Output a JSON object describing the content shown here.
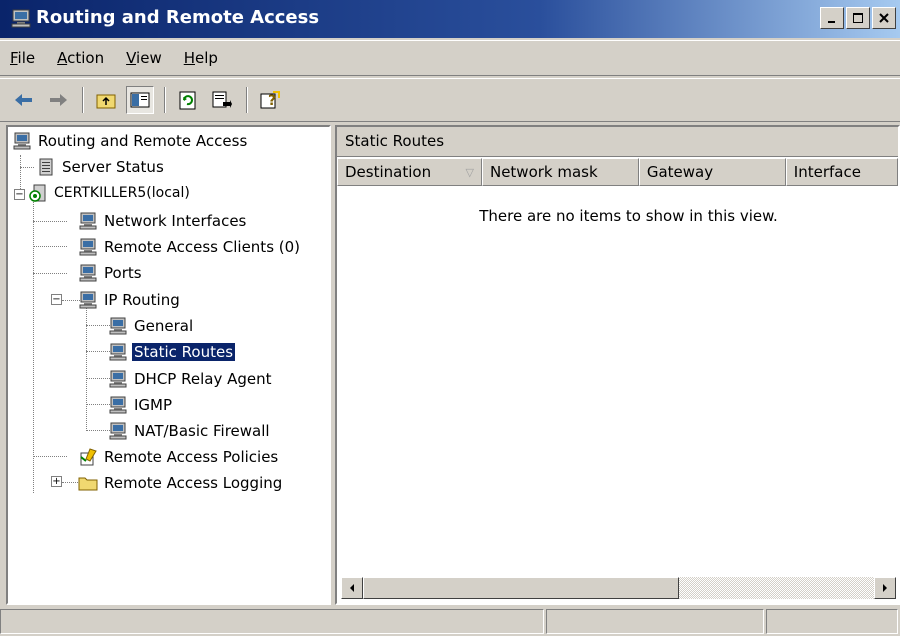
{
  "window": {
    "title": "Routing and Remote Access",
    "controls": {
      "minimize": "_",
      "maximize": "□",
      "close": "×"
    }
  },
  "menubar": [
    {
      "key": "F",
      "rest": "ile"
    },
    {
      "key": "A",
      "rest": "ction"
    },
    {
      "key": "V",
      "rest": "iew"
    },
    {
      "key": "H",
      "rest": "elp"
    }
  ],
  "toolbar": {
    "icons": [
      "back-arrow-icon",
      "forward-arrow-icon",
      "up-one-level-icon",
      "show-hide-console-tree-icon",
      "refresh-icon",
      "export-list-icon",
      "help-icon"
    ]
  },
  "tree": {
    "items": [
      {
        "label": "Routing and Remote Access",
        "icon": "computer-icon"
      },
      {
        "label": "Server Status",
        "icon": "server-status-icon"
      },
      {
        "label": "CERTKILLER5(local)",
        "icon": "server-icon"
      },
      {
        "label": "Network Interfaces",
        "icon": "computer-icon"
      },
      {
        "label": "Remote Access Clients (0)",
        "icon": "computer-icon"
      },
      {
        "label": "Ports",
        "icon": "computer-icon"
      },
      {
        "label": "IP Routing",
        "icon": "computer-icon"
      },
      {
        "label": "General",
        "icon": "computer-icon"
      },
      {
        "label": "Static Routes",
        "icon": "computer-icon"
      },
      {
        "label": "DHCP Relay Agent",
        "icon": "computer-icon"
      },
      {
        "label": "IGMP",
        "icon": "computer-icon"
      },
      {
        "label": "NAT/Basic Firewall",
        "icon": "computer-icon"
      },
      {
        "label": "Remote Access Policies",
        "icon": "policy-icon"
      },
      {
        "label": "Remote Access Logging",
        "icon": "folder-icon"
      }
    ],
    "selected": "Static Routes"
  },
  "right_pane": {
    "header": "Static Routes",
    "columns": [
      "Destination",
      "Network mask",
      "Gateway",
      "Interface"
    ],
    "sort_indicator": "▽",
    "empty_message": "There are no items to show in this view."
  },
  "colors": {
    "selection": "#0a246a",
    "titlebar_start": "#0a246a",
    "titlebar_end": "#a6caf0",
    "face": "#d4d0c8"
  }
}
